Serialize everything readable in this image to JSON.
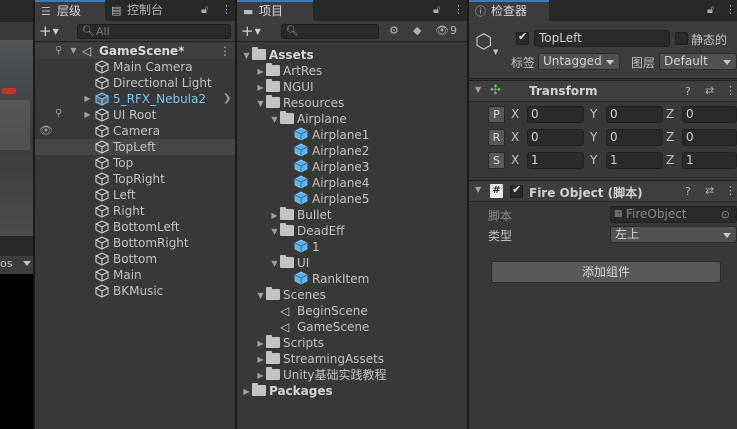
{
  "colors": {
    "accent": "#3a79bb",
    "prefab_blue": "#7cc3f6",
    "panel_bg": "#383838",
    "selection": "#464646"
  },
  "game_view": {
    "toolbar_text": "os"
  },
  "hierarchy": {
    "tab_label": "层级",
    "console_tab_label": "控制台",
    "search_placeholder": "All",
    "scene_name": "GameScene*",
    "items": [
      {
        "label": "Main Camera",
        "icon": "gameobject-icon"
      },
      {
        "label": "Directional Light",
        "icon": "gameobject-icon"
      },
      {
        "label": "5_RFX_Nebula2",
        "icon": "prefab-icon",
        "prefab": true
      },
      {
        "label": "UI Root",
        "icon": "gameobject-icon"
      },
      {
        "label": "Camera",
        "icon": "gameobject-icon"
      },
      {
        "label": "TopLeft",
        "icon": "gameobject-icon",
        "selected": true
      },
      {
        "label": "Top",
        "icon": "gameobject-icon"
      },
      {
        "label": "TopRight",
        "icon": "gameobject-icon"
      },
      {
        "label": "Left",
        "icon": "gameobject-icon"
      },
      {
        "label": "Right",
        "icon": "gameobject-icon"
      },
      {
        "label": "BottomLeft",
        "icon": "gameobject-icon"
      },
      {
        "label": "BottomRight",
        "icon": "gameobject-icon"
      },
      {
        "label": "Bottom",
        "icon": "gameobject-icon"
      },
      {
        "label": "Main",
        "icon": "gameobject-icon"
      },
      {
        "label": "BKMusic",
        "icon": "gameobject-icon"
      }
    ]
  },
  "project": {
    "tab_label": "项目",
    "hidden_count": "9",
    "tree": [
      {
        "label": "Assets",
        "type": "folder",
        "expanded": true,
        "bold": true
      },
      {
        "label": "ArtRes",
        "type": "folder"
      },
      {
        "label": "NGUI",
        "type": "folder"
      },
      {
        "label": "Resources",
        "type": "folder",
        "expanded": true
      },
      {
        "label": "Airplane",
        "type": "folder",
        "expanded": true
      },
      {
        "label": "Airplane1",
        "type": "prefab"
      },
      {
        "label": "Airplane2",
        "type": "prefab"
      },
      {
        "label": "Airplane3",
        "type": "prefab"
      },
      {
        "label": "Airplane4",
        "type": "prefab"
      },
      {
        "label": "Airplane5",
        "type": "prefab"
      },
      {
        "label": "Bullet",
        "type": "folder"
      },
      {
        "label": "DeadEff",
        "type": "folder",
        "expanded": true
      },
      {
        "label": "1",
        "type": "prefab"
      },
      {
        "label": "UI",
        "type": "folder",
        "expanded": true
      },
      {
        "label": "RankItem",
        "type": "prefab"
      },
      {
        "label": "Scenes",
        "type": "folder",
        "expanded": true
      },
      {
        "label": "BeginScene",
        "type": "scene"
      },
      {
        "label": "GameScene",
        "type": "scene"
      },
      {
        "label": "Scripts",
        "type": "folder"
      },
      {
        "label": "StreamingAssets",
        "type": "folder"
      },
      {
        "label": "Unity基础实践教程",
        "type": "folder"
      },
      {
        "label": "Packages",
        "type": "folder",
        "bold": true
      }
    ]
  },
  "inspector": {
    "tab_label": "检查器",
    "object_name": "TopLeft",
    "static_label": "静态的",
    "tag_label": "标签",
    "tag_value": "Untagged",
    "layer_label": "图层",
    "layer_value": "Default",
    "transform": {
      "title": "Transform",
      "position": {
        "btn": "P",
        "x": "0",
        "y": "0",
        "z": "0"
      },
      "rotation": {
        "btn": "R",
        "x": "0",
        "y": "0",
        "z": "0"
      },
      "scale": {
        "btn": "S",
        "x": "1",
        "y": "1",
        "z": "1"
      },
      "axis_x": "X",
      "axis_y": "Y",
      "axis_z": "Z"
    },
    "fire_object": {
      "title": "Fire Object (脚本)",
      "script_label": "脚本",
      "script_value": "FireObject",
      "type_label": "类型",
      "type_value": "左上"
    },
    "add_component_label": "添加组件"
  }
}
